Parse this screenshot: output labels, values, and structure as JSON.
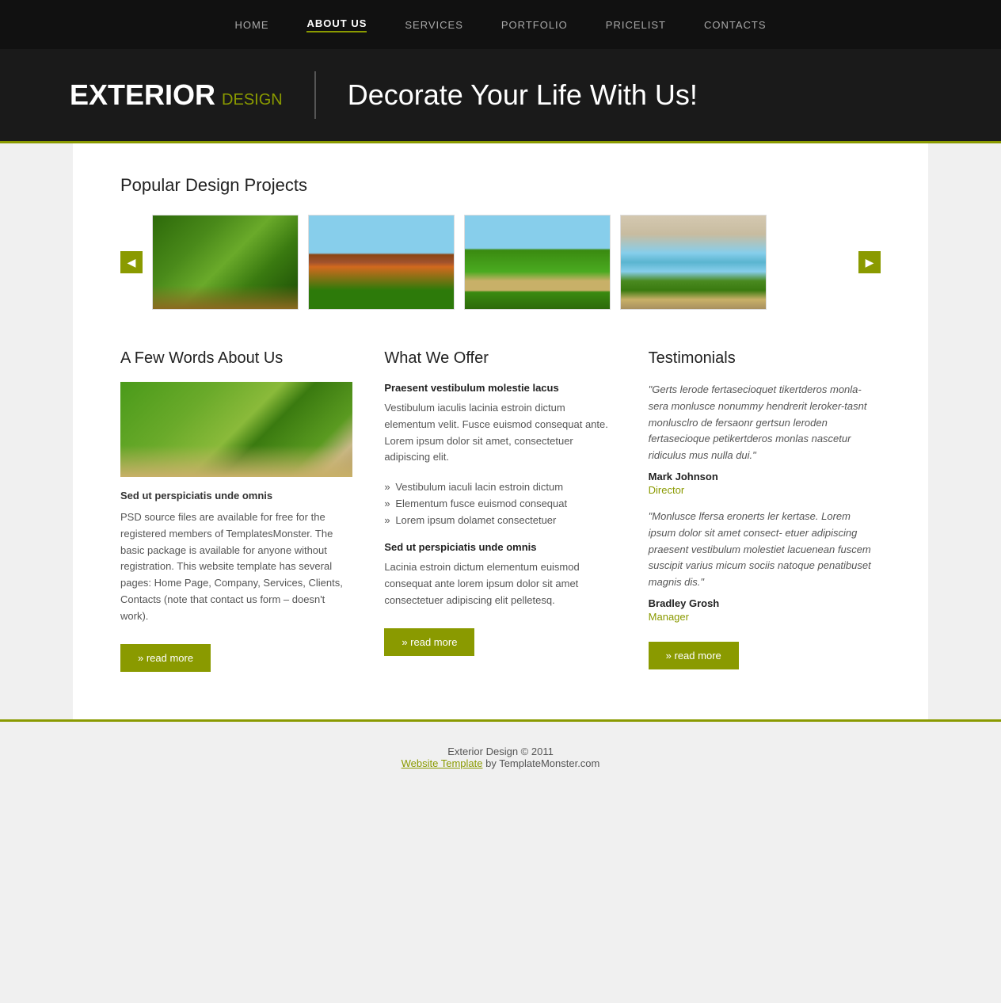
{
  "nav": {
    "items": [
      {
        "label": "HOME",
        "active": false
      },
      {
        "label": "ABOUT US",
        "active": true
      },
      {
        "label": "SERVICES",
        "active": false
      },
      {
        "label": "PORTFOLIO",
        "active": false
      },
      {
        "label": "PRICELIST",
        "active": false
      },
      {
        "label": "CONTACTS",
        "active": false
      }
    ]
  },
  "hero": {
    "logo_main": "EXTERIOR",
    "logo_sub": "DESIGN",
    "tagline": "Decorate Your Life With Us!"
  },
  "popular": {
    "title": "Popular Design Projects"
  },
  "about": {
    "title": "A Few Words About Us",
    "subtitle": "Sed ut perspiciatis unde omnis",
    "text": "PSD source files are available for free for the registered members of TemplatesMonster. The basic package is available for anyone without registration. This website template has several pages: Home Page, Company, Services, Clients, Contacts (note that contact us form – doesn't work).",
    "btn": "» read more"
  },
  "offer": {
    "title": "What We Offer",
    "subtitle1": "Praesent vestibulum molestie lacus",
    "text1": "Vestibulum iaculis lacinia estroin dictum elementum velit. Fusce euismod consequat ante. Lorem ipsum dolor sit amet, consectetuer adipiscing elit.",
    "list": [
      "Vestibulum iaculi lacin estroin dictum",
      "Elementum fusce euismod consequat",
      "Lorem ipsum dolamet consectetuer"
    ],
    "subtitle2": "Sed ut perspiciatis unde omnis",
    "text2": "Lacinia estroin dictum elementum euismod consequat ante lorem ipsum dolor sit amet consectetuer adipiscing elit pelletesq.",
    "btn": "» read more"
  },
  "testimonials": {
    "title": "Testimonials",
    "items": [
      {
        "quote": "\"Gerts lerode fertasecioquet tikertderos monla-sera monlusce nonummy hendrerit leroker-tasnt monlusclro de fersaonr gertsun leroden fertasecioque petikertderos monlas nascetur ridiculus mus nulla dui.\"",
        "name": "Mark Johnson",
        "role": "Director"
      },
      {
        "quote": "\"Monlusce lfersa eronerts ler kertase. Lorem ipsum dolor sit amet consect- etuer adipiscing praesent vestibulum molestiet lacuenean fuscem suscipit varius micum sociis natoque penatibuset magnis dis.\"",
        "name": "Bradley Grosh",
        "role": "Manager"
      }
    ],
    "btn": "» read more"
  },
  "footer": {
    "copyright": "Exterior Design © 2011",
    "link_text": "Website Template",
    "suffix": " by TemplateMonster.com"
  }
}
